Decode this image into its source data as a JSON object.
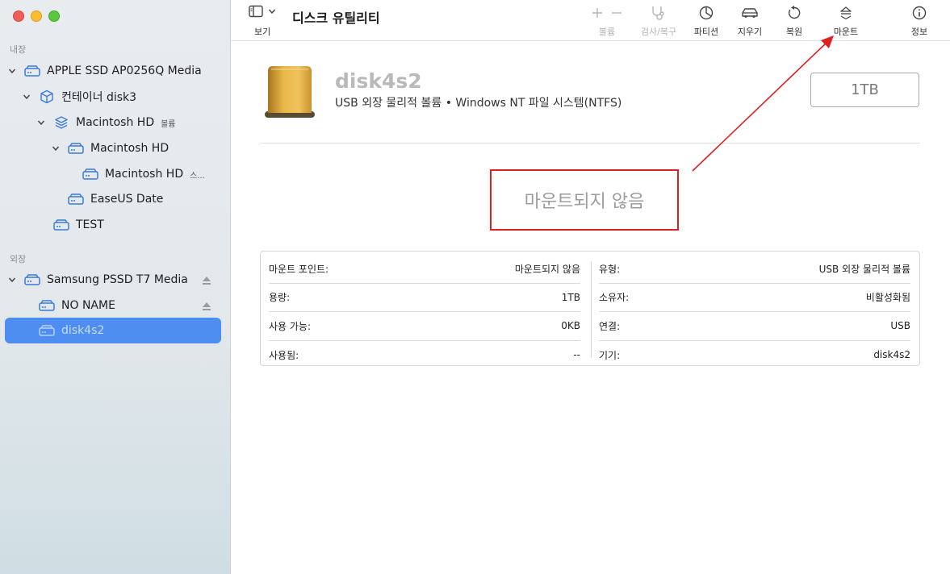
{
  "sidebar": {
    "internal_label": "내장",
    "external_label": "외장",
    "items": [
      {
        "label": "APPLE SSD AP0256Q Media"
      },
      {
        "label": "컨테이너 disk3"
      },
      {
        "label": "Macintosh HD",
        "sub": "볼륨"
      },
      {
        "label": "Macintosh HD"
      },
      {
        "label": "Macintosh HD",
        "sub": "스..."
      },
      {
        "label": "EaseUS Date"
      },
      {
        "label": "TEST"
      },
      {
        "label": "Samsung PSSD T7 Media"
      },
      {
        "label": "NO NAME"
      },
      {
        "label": "disk4s2"
      }
    ]
  },
  "toolbar": {
    "view_label": "보기",
    "title": "디스크 유틸리티",
    "buttons": {
      "volume": "볼륨",
      "firstaid": "검사/복구",
      "partition": "파티션",
      "erase": "지우기",
      "restore": "복원",
      "mount": "마운트",
      "info": "정보"
    }
  },
  "disk": {
    "name": "disk4s2",
    "description": "USB 외장 물리적 볼륨 • Windows NT 파일 시스템(NTFS)",
    "size": "1TB",
    "status": "마운트되지 않음"
  },
  "info": {
    "left": [
      {
        "label": "마운트 포인트:",
        "value": "마운트되지 않음"
      },
      {
        "label": "용량:",
        "value": "1TB"
      },
      {
        "label": "사용 가능:",
        "value": "0KB"
      },
      {
        "label": "사용됨:",
        "value": "--"
      }
    ],
    "right": [
      {
        "label": "유형:",
        "value": "USB 외장 물리적 볼륨"
      },
      {
        "label": "소유자:",
        "value": "비활성화됨"
      },
      {
        "label": "연결:",
        "value": "USB"
      },
      {
        "label": "기기:",
        "value": "disk4s2"
      }
    ]
  },
  "colors": {
    "accent": "#4e8ef0",
    "annotation_red": "#e02020",
    "disk_gold": "#e0a93a"
  }
}
